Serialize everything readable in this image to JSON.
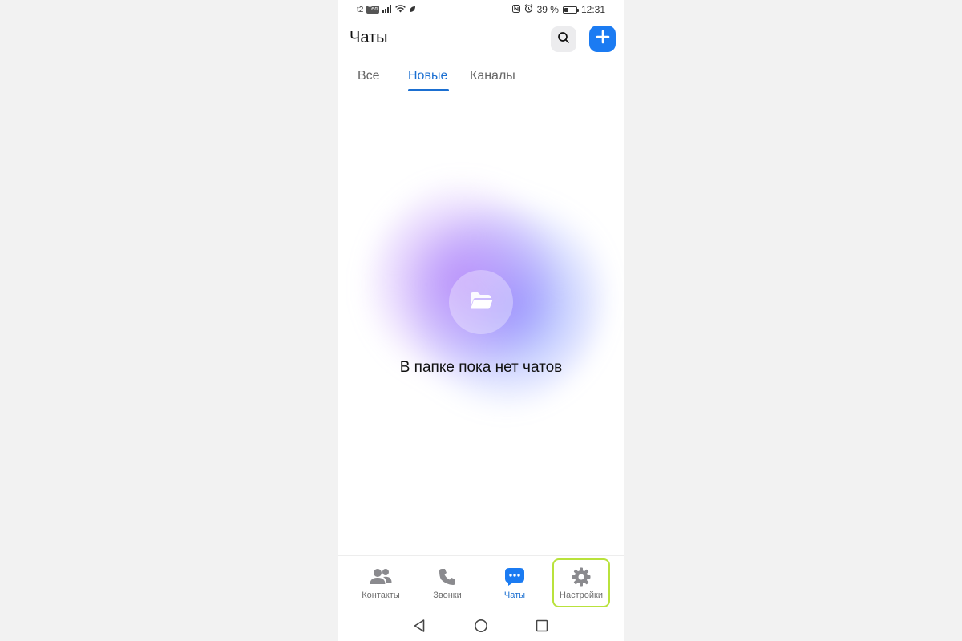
{
  "status_bar": {
    "carrier": "t2",
    "carrier_badge": "Тел",
    "battery_percent": "39 %",
    "battery_level": 0.39,
    "time": "12:31"
  },
  "header": {
    "title": "Чаты",
    "search_icon": "search-icon",
    "add_icon": "plus-icon"
  },
  "tabs": [
    {
      "label": "Все",
      "active": false
    },
    {
      "label": "Новые",
      "active": true
    },
    {
      "label": "Каналы",
      "active": false
    }
  ],
  "empty_state": {
    "icon": "folder-icon",
    "text": "В папке пока нет чатов"
  },
  "bottom_nav": [
    {
      "label": "Контакты",
      "icon": "contacts-icon",
      "active": false
    },
    {
      "label": "Звонки",
      "icon": "phone-icon",
      "active": false
    },
    {
      "label": "Чаты",
      "icon": "chat-bubble-icon",
      "active": true
    },
    {
      "label": "Настройки",
      "icon": "gear-icon",
      "active": false,
      "highlighted": true
    }
  ],
  "colors": {
    "accent": "#1b6fd1",
    "button_blue": "#1b7bf2",
    "highlight": "#b9e23c",
    "inactive": "#707070"
  }
}
